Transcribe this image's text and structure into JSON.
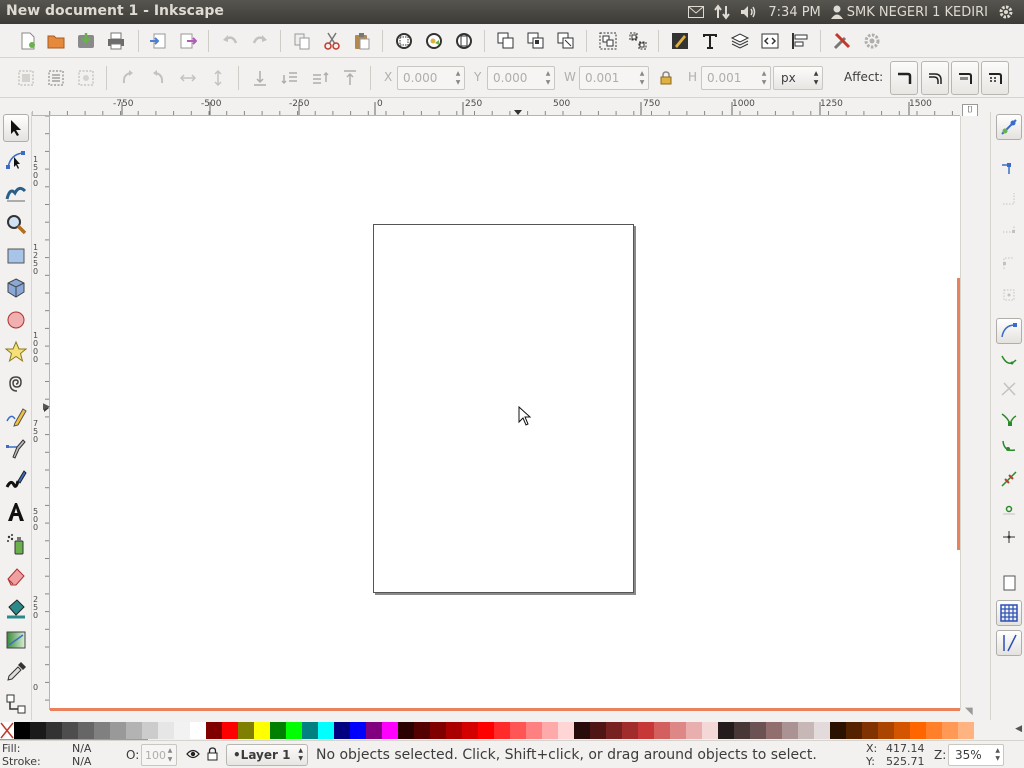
{
  "window": {
    "title": "New document 1 - Inkscape"
  },
  "tray": {
    "time": "7:34 PM",
    "user": "SMK NEGERI 1 KEDIRI"
  },
  "controls": {
    "x_label": "X",
    "x_value": "0.000",
    "y_label": "Y",
    "y_value": "0.000",
    "w_label": "W",
    "w_value": "0.001",
    "h_label": "H",
    "h_value": "0.001",
    "unit": "px",
    "affect_label": "Affect:"
  },
  "ruler": {
    "h_labels": [
      "-750",
      "-500",
      "-250",
      "0",
      "250",
      "500",
      "750",
      "1000",
      "1250",
      "1500"
    ],
    "v_labels": [
      "1500",
      "1250",
      "1000",
      "750",
      "500",
      "250",
      "0"
    ]
  },
  "palette": {
    "colors": [
      "#000000",
      "#1a1a1a",
      "#333333",
      "#4d4d4d",
      "#666666",
      "#808080",
      "#999999",
      "#b3b3b3",
      "#cccccc",
      "#e6e6e6",
      "#f2f2f2",
      "#ffffff",
      "#800000",
      "#ff0000",
      "#808000",
      "#ffff00",
      "#008000",
      "#00ff00",
      "#008080",
      "#00ffff",
      "#000080",
      "#0000ff",
      "#800080",
      "#ff00ff",
      "#2b0000",
      "#550000",
      "#800000",
      "#aa0000",
      "#d40000",
      "#ff0000",
      "#ff2a2a",
      "#ff5555",
      "#ff8080",
      "#ffaaaa",
      "#ffd5d5",
      "#280b0b",
      "#501616",
      "#782121",
      "#a02c2c",
      "#c83737",
      "#d35f5f",
      "#de8787",
      "#e9afaf",
      "#f4d7d7",
      "#241c1c",
      "#483737",
      "#6c5353",
      "#916f6f",
      "#ac9393",
      "#c8b7b7",
      "#e3dbdb",
      "#2b1100",
      "#552200",
      "#803300",
      "#aa4400",
      "#d45500",
      "#ff6600",
      "#ff7f2a",
      "#ff9955",
      "#ffb380"
    ]
  },
  "status": {
    "fill_label": "Fill:",
    "fill_value": "N/A",
    "stroke_label": "Stroke:",
    "stroke_value": "N/A",
    "opacity_label": "O:",
    "opacity_value": "100",
    "layer": "•Layer 1",
    "message": "No objects selected. Click, Shift+click, or drag around objects to select.",
    "x_label": "X:",
    "x_value": "417.14",
    "y_label": "Y:",
    "y_value": "525.71",
    "zoom_label": "Z:",
    "zoom_value": "35%"
  }
}
